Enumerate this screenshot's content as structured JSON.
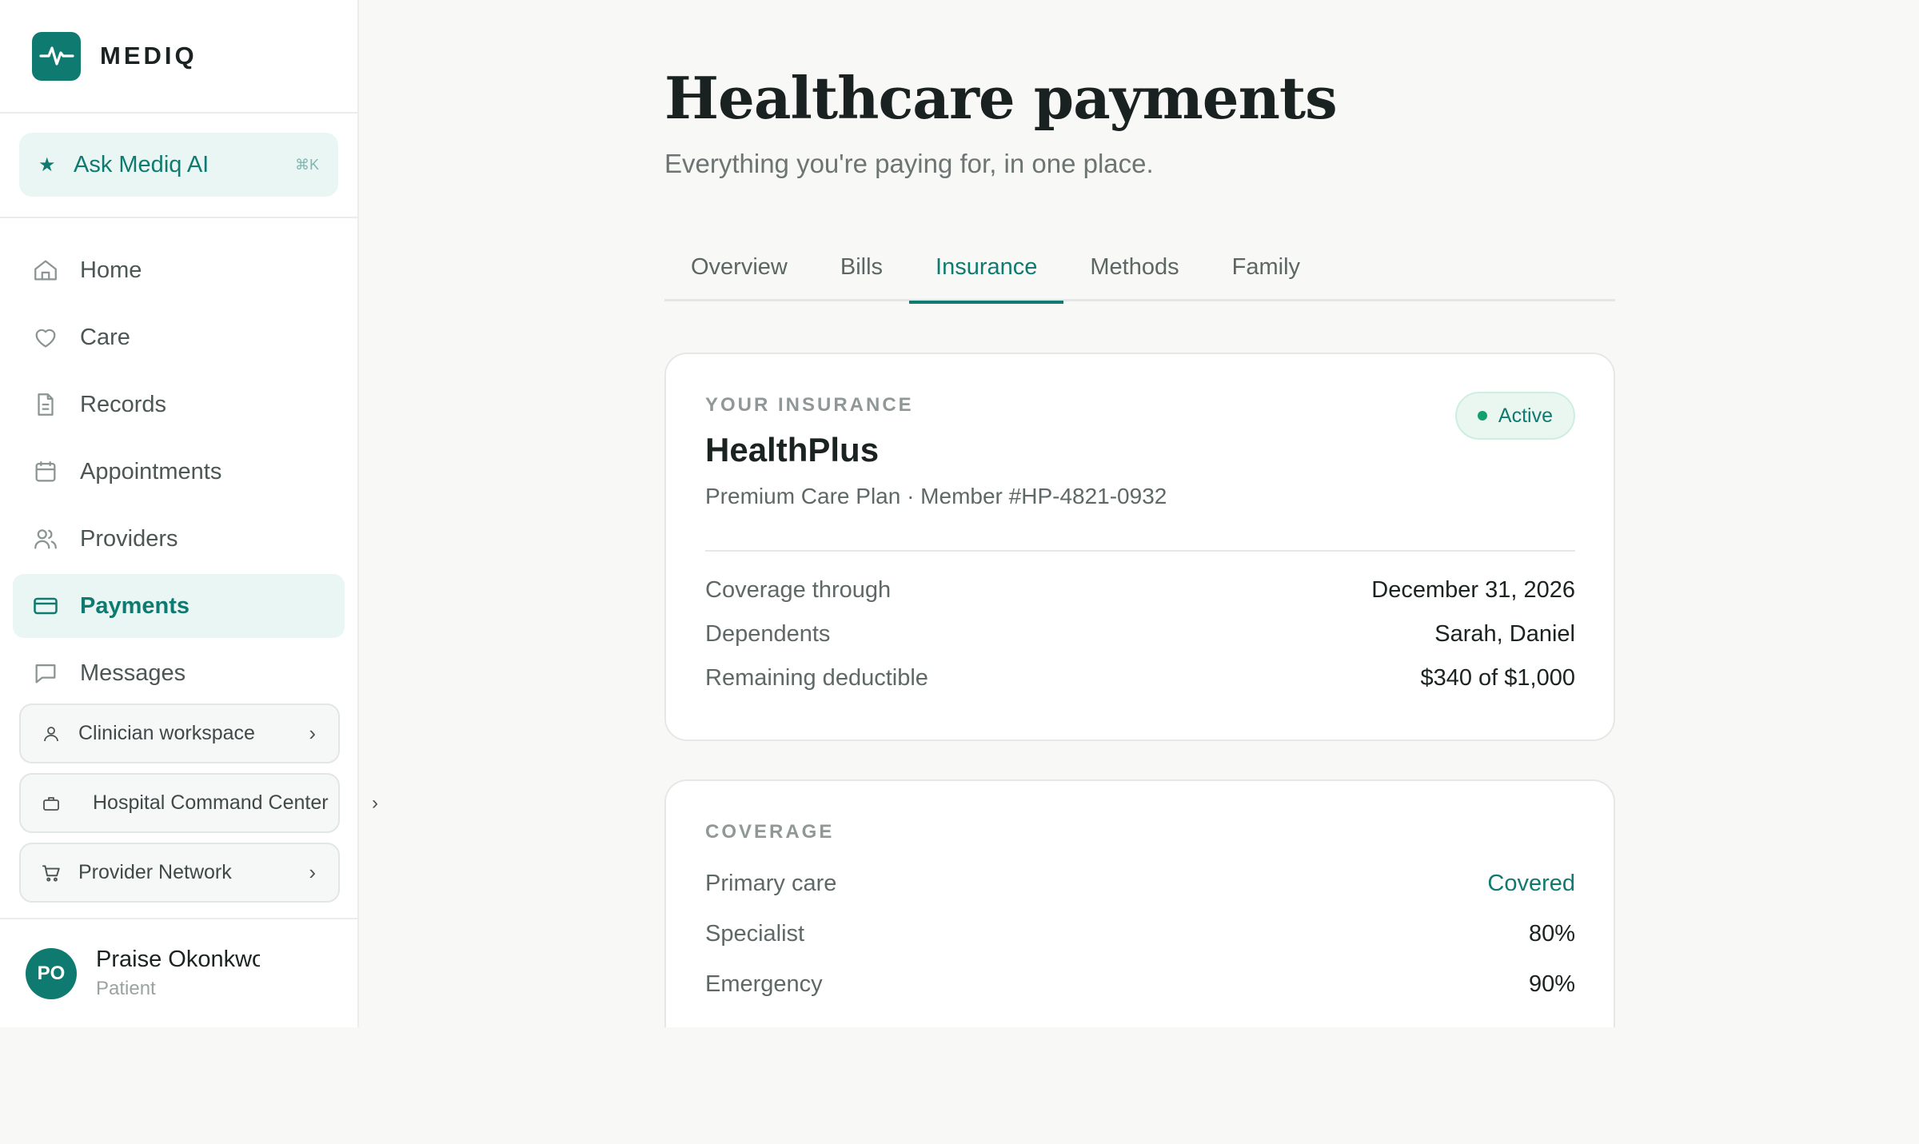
{
  "app": {
    "brand": "MEDIQ"
  },
  "ask": {
    "label": "Ask Mediq AI",
    "shortcut": "⌘K"
  },
  "nav": [
    {
      "label": "Home",
      "icon": "home-icon"
    },
    {
      "label": "Care",
      "icon": "heart-icon"
    },
    {
      "label": "Records",
      "icon": "document-icon"
    },
    {
      "label": "Appointments",
      "icon": "calendar-icon"
    },
    {
      "label": "Providers",
      "icon": "users-icon"
    },
    {
      "label": "Payments",
      "icon": "credit-card-icon",
      "active": true
    },
    {
      "label": "Messages",
      "icon": "message-icon"
    }
  ],
  "workspaces": [
    {
      "label": "Clinician workspace",
      "icon": "user-icon"
    },
    {
      "label": "Hospital Command Center",
      "icon": "briefcase-icon"
    },
    {
      "label": "Provider Network",
      "icon": "cart-icon"
    }
  ],
  "user": {
    "initials": "PO",
    "name": "Praise Okonkwo",
    "role": "Patient"
  },
  "page": {
    "title": "Healthcare payments",
    "subtitle": "Everything you're paying for, in one place."
  },
  "tabs": [
    {
      "label": "Overview"
    },
    {
      "label": "Bills"
    },
    {
      "label": "Insurance",
      "active": true
    },
    {
      "label": "Methods"
    },
    {
      "label": "Family"
    }
  ],
  "insurance": {
    "section_label": "YOUR INSURANCE",
    "provider": "HealthPlus",
    "plan": "Premium Care Plan · Member #HP-4821-0932",
    "status": "Active",
    "details": [
      {
        "label": "Coverage through",
        "value": "December 31, 2026"
      },
      {
        "label": "Dependents",
        "value": "Sarah, Daniel"
      },
      {
        "label": "Remaining deductible",
        "value": "$340 of $1,000"
      }
    ]
  },
  "coverage": {
    "section_label": "COVERAGE",
    "items": [
      {
        "label": "Primary care",
        "value": "Covered"
      },
      {
        "label": "Specialist",
        "value": "80%"
      },
      {
        "label": "Emergency",
        "value": "90%"
      }
    ]
  },
  "colors": {
    "accent": "#0f7a70",
    "status_active": "#12a06e",
    "background": "#f8f8f6"
  }
}
